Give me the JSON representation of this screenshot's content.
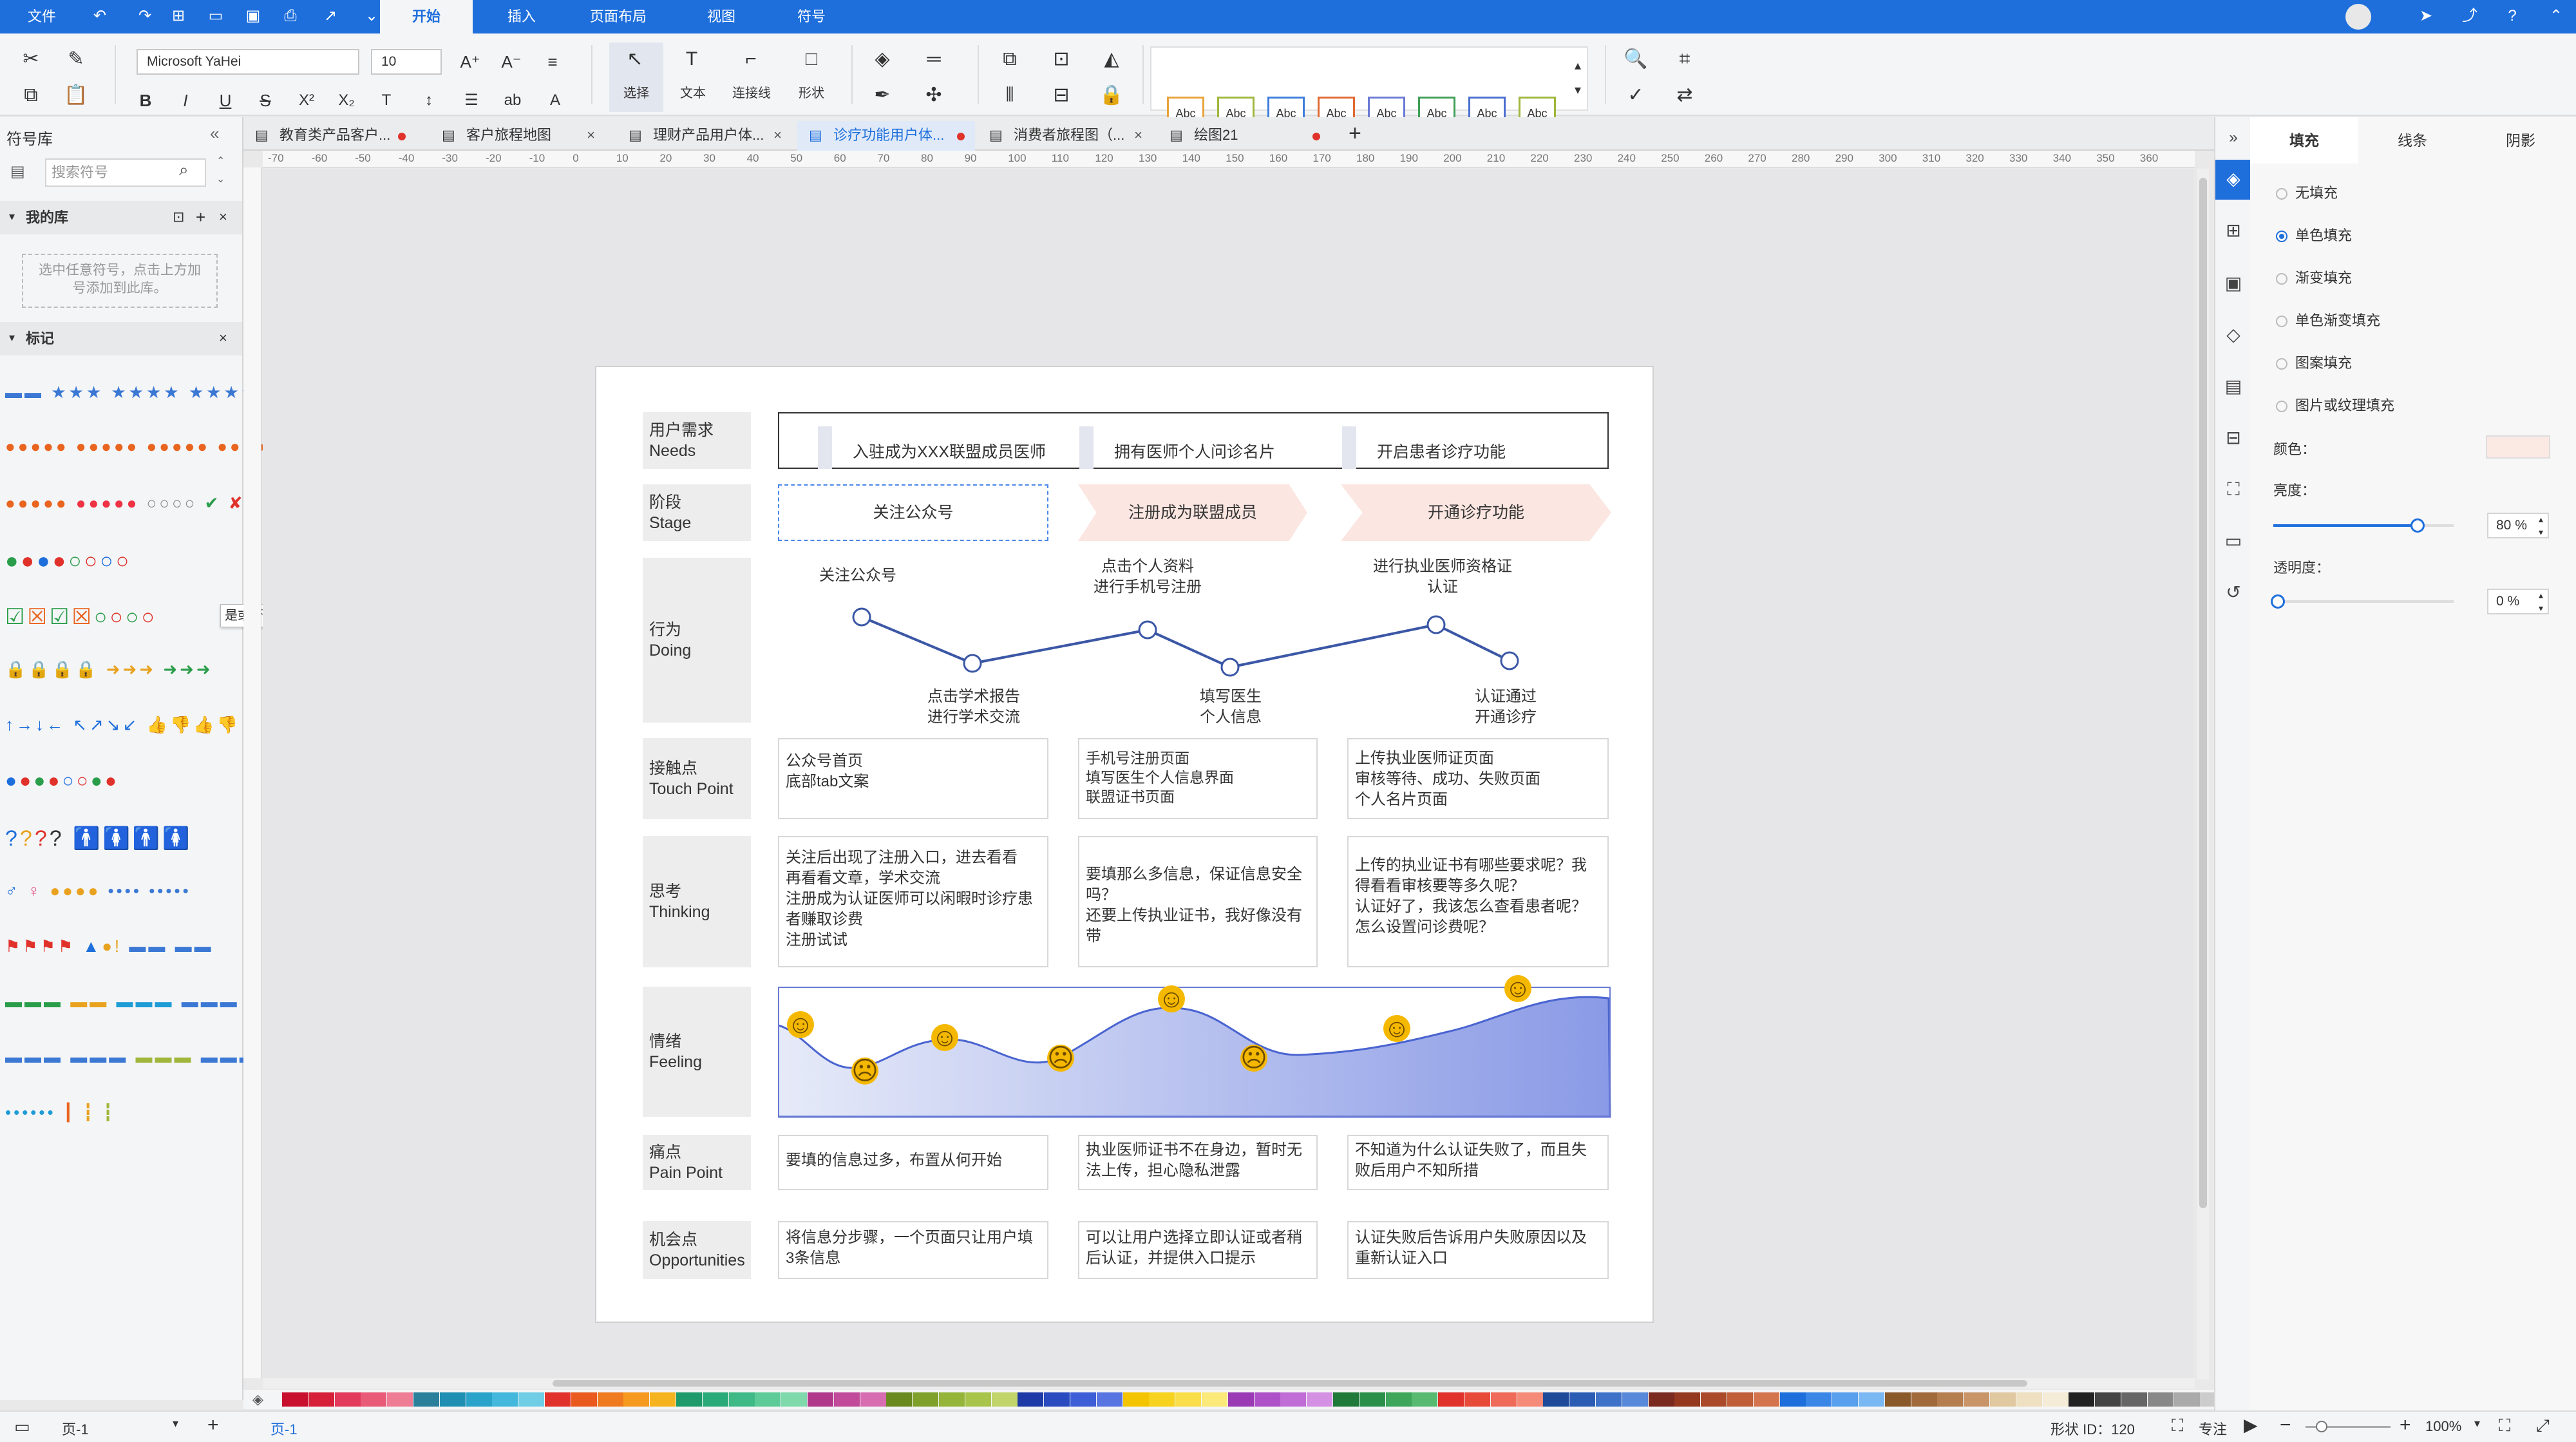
{
  "menubar": {
    "file": "文件",
    "tabs": [
      "开始",
      "插入",
      "页面布局",
      "视图",
      "符号"
    ]
  },
  "ribbon": {
    "font_name": "Microsoft YaHei",
    "font_size": "10",
    "tools": [
      "选择",
      "文本",
      "连接线",
      "形状"
    ],
    "style_swatches": [
      {
        "label": "Abc",
        "color": "#e8a33a"
      },
      {
        "label": "Abc",
        "color": "#9fb63b"
      },
      {
        "label": "Abc",
        "color": "#3d7ddb"
      },
      {
        "label": "Abc",
        "color": "#e06a32"
      },
      {
        "label": "Abc",
        "color": "#6a7ad4"
      },
      {
        "label": "Abc",
        "color": "#3f9f58"
      },
      {
        "label": "Abc",
        "color": "#4a6fd0"
      },
      {
        "label": "Abc",
        "color": "#9fb63b"
      }
    ]
  },
  "left_panel": {
    "title": "符号库",
    "search_placeholder": "搜索符号",
    "my_library": "我的库",
    "my_library_hint": "选中任意符号，点击上方加号添加到此库。",
    "marks_section": "标记",
    "tooltip": "是或否"
  },
  "doc_tabs": [
    {
      "label": "教育类产品客户...",
      "dot": true
    },
    {
      "label": "客户旅程地图",
      "dot": false
    },
    {
      "label": "理财产品用户体...",
      "dot": false
    },
    {
      "label": "诊疗功能用户体...",
      "dot": true
    },
    {
      "label": "消费者旅程图（...",
      "dot": false
    },
    {
      "label": "绘图21",
      "dot": true
    }
  ],
  "ruler": {
    "top_ticks": [
      "-70",
      "-60",
      "-50",
      "-40",
      "-30",
      "-20",
      "-10",
      "0",
      "10",
      "20",
      "30",
      "40",
      "50",
      "60",
      "70",
      "80",
      "90",
      "100",
      "110",
      "120",
      "130",
      "140",
      "150",
      "160",
      "170",
      "180",
      "190",
      "200",
      "210",
      "220",
      "230",
      "240",
      "250",
      "260",
      "270",
      "280",
      "290",
      "300",
      "310",
      "320",
      "330",
      "340",
      "350",
      "360"
    ]
  },
  "journey": {
    "rows": {
      "needs": {
        "cn": "用户需求",
        "en": "Needs"
      },
      "stage": {
        "cn": "阶段",
        "en": "Stage"
      },
      "doing": {
        "cn": "行为",
        "en": "Doing"
      },
      "touch": {
        "cn": "接触点",
        "en": "Touch Point"
      },
      "thinking": {
        "cn": "思考",
        "en": "Thinking"
      },
      "feeling": {
        "cn": "情绪",
        "en": "Feeling"
      },
      "pain": {
        "cn": "痛点",
        "en": "Pain Point"
      },
      "opp": {
        "cn": "机会点",
        "en": "Opportunities"
      }
    },
    "needs": [
      "入驻成为XXX联盟成员医师",
      "拥有医师个人问诊名片",
      "开启患者诊疗功能"
    ],
    "stages": [
      "关注公众号",
      "注册成为联盟成员",
      "开通诊疗功能"
    ],
    "doing_top": [
      "关注公众号",
      "点击个人资料\n进行手机号注册",
      "进行执业医师资格证\n认证"
    ],
    "doing_bottom": [
      "点击学术报告\n进行学术交流",
      "填写医生\n个人信息",
      "认证通过\n开通诊疗"
    ],
    "touch_points": [
      "公众号首页\n底部tab文案",
      "手机号注册页面\n填写医生个人信息界面\n联盟证书页面",
      "上传执业医师证页面\n审核等待、成功、失败页面\n个人名片页面"
    ],
    "thinking": [
      "关注后出现了注册入口，进去看看\n再看看文章，学术交流\n注册成为认证医师可以闲暇时诊疗患者赚取诊费\n注册试试",
      "要填那么多信息，保证信息安全吗？\n还要上传执业证书，我好像没有带",
      "上传的执业证书有哪些要求呢？我得看看审核要等多久呢？\n认证好了，我该怎么查看患者呢？怎么设置问诊费呢？"
    ],
    "pain_points": [
      "要填的信息过多，布置从何开始",
      "执业医师证书不在身边，暂时无法上传，担心隐私泄露",
      "不知道为什么认证失败了，而且失败后用户不知所措"
    ],
    "opportunities": [
      "将信息分步骤，一个页面只让用户填3条信息",
      "可以让用户选择立即认证或者稍后认证，并提供入口提示",
      "认证失败后告诉用户失败原因以及重新认证入口"
    ],
    "feeling_faces": [
      "happy",
      "sad",
      "neutral",
      "sad",
      "happy",
      "sad",
      "happy",
      "happy"
    ]
  },
  "right_panel": {
    "tabs": [
      "填充",
      "线条",
      "阴影"
    ],
    "fill_options": [
      "无填充",
      "单色填充",
      "渐变填充",
      "单色渐变填充",
      "图案填充",
      "图片或纹理填充"
    ],
    "selected_fill": "单色填充",
    "color_label": "颜色：",
    "fill_color": "#fbe9e4",
    "brightness_label": "亮度：",
    "brightness_value": "80 %",
    "brightness_level": 0.8,
    "transparency_label": "透明度：",
    "transparency_value": "0 %",
    "transparency_level": 0
  },
  "status": {
    "page_label": "页-1",
    "page_tab": "页-1",
    "shape_id": "形状 ID：120",
    "focus": "专注",
    "zoom": "100%"
  }
}
